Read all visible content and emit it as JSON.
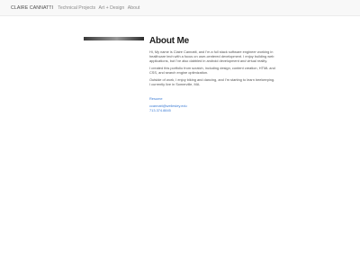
{
  "nav": {
    "brand": "CLAIRE CANNATTI",
    "links": [
      "Technical Projects",
      "Art + Design",
      "About"
    ]
  },
  "about": {
    "title": "About Me",
    "paragraphs": [
      "Hi, My name is Claire Cannatti, and I'm a full stack software engineer working in healthcare tech with a focus on user-centered development. I enjoy building web applications, but I've also dabbled in android development and virtual reality.",
      "I created this portfolio from scratch, including design, content creation, HTML and CSS, and search engine optimization.",
      "Outside of work, I enjoy biking and dancing, and I'm starting to learn beekeeping. I currently live in Somerville, MA."
    ],
    "resume_label": "Resume",
    "email": "ccannatt@wellesley.edu",
    "phone": "713.374.8845"
  },
  "colors": {
    "link": "#3b7bd4",
    "navbar_bg": "#f8f8f8",
    "text": "#555555"
  }
}
